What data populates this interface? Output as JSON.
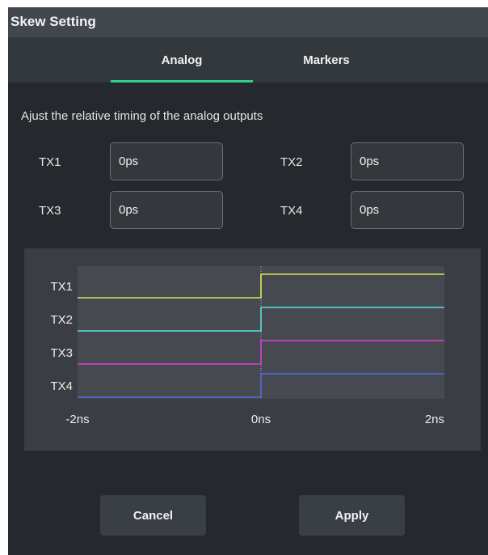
{
  "dialog": {
    "title": "Skew Setting",
    "tabs": [
      {
        "label": "Analog",
        "active": true
      },
      {
        "label": "Markers",
        "active": false
      }
    ],
    "description": "Ajust the relative timing of the analog outputs",
    "fields": [
      {
        "label": "TX1",
        "value": "0ps"
      },
      {
        "label": "TX2",
        "value": "0ps"
      },
      {
        "label": "TX3",
        "value": "0ps"
      },
      {
        "label": "TX4",
        "value": "0ps"
      }
    ],
    "buttons": {
      "cancel": "Cancel",
      "apply": "Apply"
    },
    "colors": {
      "accent": "#2fd08a"
    }
  },
  "chart_data": {
    "type": "line",
    "x_tick_labels": [
      "-2ns",
      "0ns",
      "2ns"
    ],
    "xlim": [
      -2,
      2
    ],
    "x_unit": "ns",
    "series": [
      {
        "name": "TX1",
        "color": "#e6e65a",
        "x": [
          -2,
          0,
          0,
          2
        ],
        "y": [
          0,
          0,
          1,
          1
        ]
      },
      {
        "name": "TX2",
        "color": "#55e3e3",
        "x": [
          -2,
          0,
          0,
          2
        ],
        "y": [
          0,
          0,
          1,
          1
        ]
      },
      {
        "name": "TX3",
        "color": "#e23fd6",
        "x": [
          -2,
          0,
          0,
          2
        ],
        "y": [
          0,
          0,
          1,
          1
        ]
      },
      {
        "name": "TX4",
        "color": "#4f6ee0",
        "x": [
          -2,
          0,
          0,
          2
        ],
        "y": [
          0,
          0,
          1,
          1
        ]
      }
    ],
    "vertical_marker_x": 0
  }
}
